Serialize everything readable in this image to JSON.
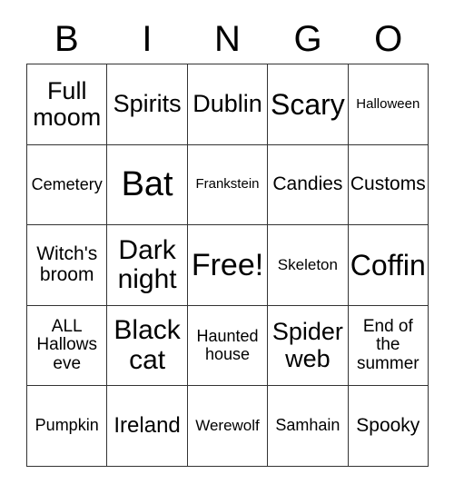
{
  "card": {
    "title": "BINGO",
    "header_letters": [
      "B",
      "I",
      "N",
      "G",
      "O"
    ],
    "colors": {
      "background": "#ffffff",
      "text": "#000000",
      "grid_line": "#333333"
    },
    "grid_size": "5x5",
    "free_space": "Free!"
  },
  "rows": [
    {
      "cells": [
        {
          "text": "Full\nmoom",
          "size": "fs-xl"
        },
        {
          "text": "Spirits",
          "size": "fs-xl"
        },
        {
          "text": "Dublin",
          "size": "fs-xl"
        },
        {
          "text": "Scary",
          "size": "fs-h1"
        },
        {
          "text": "Halloween",
          "size": "fs-xs"
        }
      ]
    },
    {
      "cells": [
        {
          "text": "Cemetery",
          "size": "fs-sm"
        },
        {
          "text": "Bat",
          "size": "fs-h3"
        },
        {
          "text": "Frankstein",
          "size": "fs-xs"
        },
        {
          "text": "Candies",
          "size": "fs-ml"
        },
        {
          "text": "Customs",
          "size": "fs-ml"
        }
      ]
    },
    {
      "cells": [
        {
          "text": "Witch's\nbroom",
          "size": "fs-ml"
        },
        {
          "text": "Dark\nnight",
          "size": "fs-xxl"
        },
        {
          "text": "Free!",
          "size": "fs-h2"
        },
        {
          "text": "Skeleton",
          "size": "fs-s"
        },
        {
          "text": "Coffin",
          "size": "fs-h1"
        }
      ]
    },
    {
      "cells": [
        {
          "text": "ALL\nHallows\neve",
          "size": "fs-m"
        },
        {
          "text": "Black\ncat",
          "size": "fs-xxl"
        },
        {
          "text": "Haunted\nhouse",
          "size": "fs-sm"
        },
        {
          "text": "Spider\nweb",
          "size": "fs-xl"
        },
        {
          "text": "End of\nthe\nsummer",
          "size": "fs-m"
        }
      ]
    },
    {
      "cells": [
        {
          "text": "Pumpkin",
          "size": "fs-sm"
        },
        {
          "text": "Ireland",
          "size": "fs-l"
        },
        {
          "text": "Werewolf",
          "size": "fs-s"
        },
        {
          "text": "Samhain",
          "size": "fs-sm"
        },
        {
          "text": "Spooky",
          "size": "fs-ml"
        }
      ]
    }
  ]
}
